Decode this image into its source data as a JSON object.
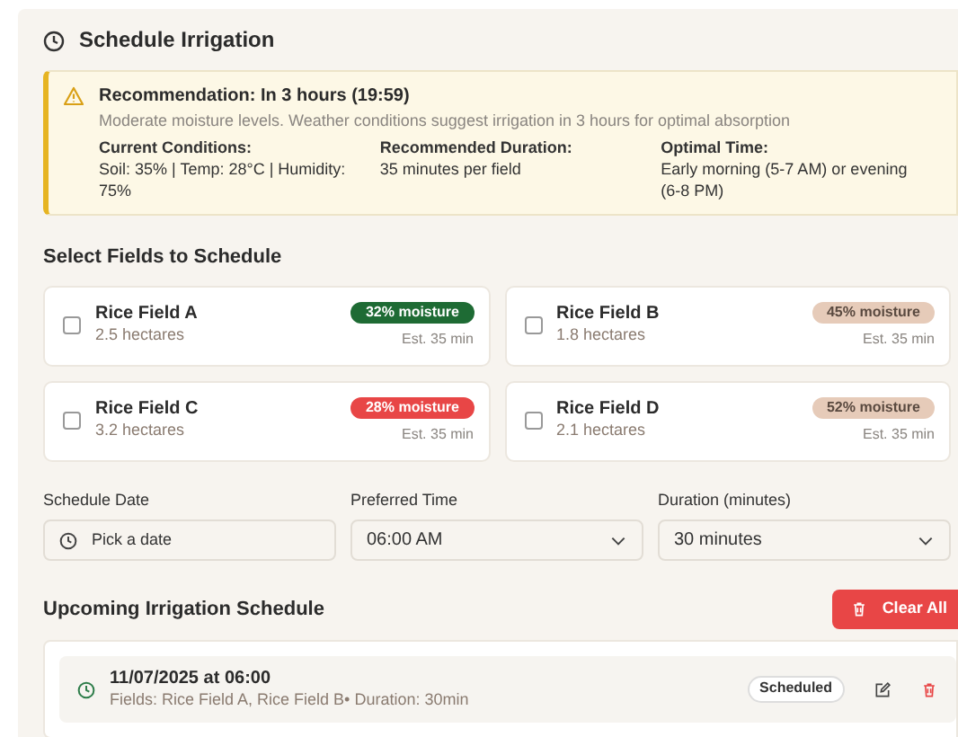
{
  "title": "Schedule Irrigation",
  "recommendation": {
    "heading": "Recommendation: In 3 hours (19:59)",
    "message": "Moderate moisture levels. Weather conditions suggest irrigation in 3 hours for optimal absorption",
    "details": [
      {
        "label": "Current Conditions:",
        "value": "Soil: 35% | Temp: 28°C | Humidity: 75%"
      },
      {
        "label": "Recommended Duration:",
        "value": "35 minutes per field"
      },
      {
        "label": "Optimal Time:",
        "value": "Early morning (5-7 AM) or evening (6-8 PM)"
      }
    ]
  },
  "fields_heading": "Select Fields to Schedule",
  "fields": [
    {
      "name": "Rice Field A",
      "area": "2.5 hectares",
      "moisture": "32% moisture",
      "color": "#1e6b34",
      "estimate": "Est. 35 min",
      "checked": false
    },
    {
      "name": "Rice Field B",
      "area": "1.8 hectares",
      "moisture": "45% moisture",
      "color": "#e6cbb9",
      "estimate": "Est. 35 min",
      "checked": false
    },
    {
      "name": "Rice Field C",
      "area": "3.2 hectares",
      "moisture": "28% moisture",
      "color": "#e84646",
      "estimate": "Est. 35 min",
      "checked": false
    },
    {
      "name": "Rice Field D",
      "area": "2.1 hectares",
      "moisture": "52% moisture",
      "color": "#e6cbb9",
      "estimate": "Est. 35 min",
      "checked": false
    }
  ],
  "form": {
    "date": {
      "label": "Schedule Date",
      "placeholder": "Pick a date"
    },
    "time": {
      "label": "Preferred Time",
      "value": "06:00 AM"
    },
    "duration": {
      "label": "Duration (minutes)",
      "value": "30 minutes"
    }
  },
  "schedule_heading": "Upcoming Irrigation Schedule",
  "clear_button": "Clear All",
  "schedule": [
    {
      "when": "11/07/2025 at 06:00",
      "details": "Fields: Rice Field A, Rice Field B• Duration: 30min",
      "status": "Scheduled"
    }
  ]
}
